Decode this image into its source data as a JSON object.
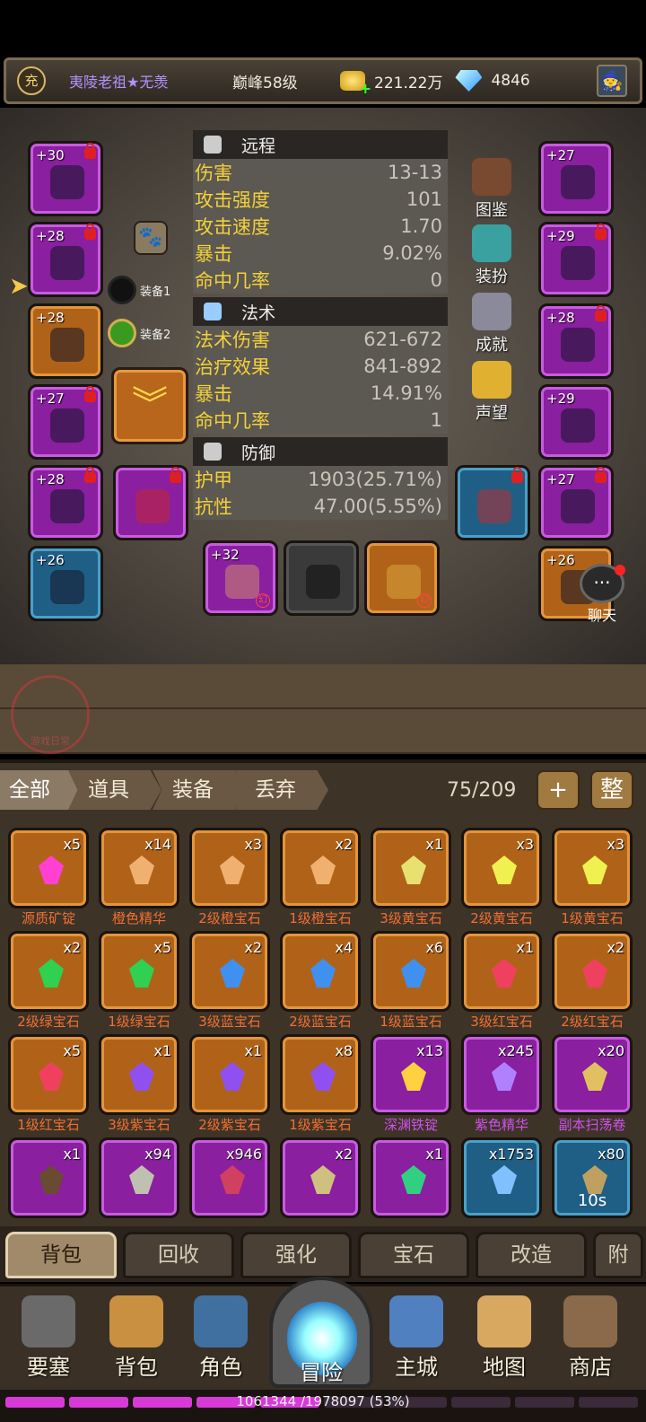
{
  "topbar": {
    "badge": "充",
    "player_name": "夷陵老祖★无羡",
    "level": "巅峰58级",
    "gold": "221.22万",
    "gems": "4846"
  },
  "colors": {
    "purple": "#8a1fa0",
    "orange": "#b06318",
    "blue": "#1f5f86",
    "stat_key": "#f2d13a",
    "item_name_orange": "#f07030",
    "item_name_purple": "#d050f0"
  },
  "stats": {
    "ranged": {
      "header": "远程",
      "rows": [
        {
          "k": "伤害",
          "v": "13-13"
        },
        {
          "k": "攻击强度",
          "v": "101"
        },
        {
          "k": "攻击速度",
          "v": "1.70"
        },
        {
          "k": "暴击",
          "v": "9.02%"
        },
        {
          "k": "命中几率",
          "v": "0"
        }
      ]
    },
    "magic": {
      "header": "法术",
      "rows": [
        {
          "k": "法术伤害",
          "v": "621-672"
        },
        {
          "k": "治疗效果",
          "v": "841-892"
        },
        {
          "k": "暴击",
          "v": "14.91%"
        },
        {
          "k": "命中几率",
          "v": "1"
        }
      ]
    },
    "defense": {
      "header": "防御",
      "rows": [
        {
          "k": "护甲",
          "v": "1903(25.71%)"
        },
        {
          "k": "抗性",
          "v": "47.00(5.55%)"
        }
      ]
    }
  },
  "side_buttons": [
    "图鉴",
    "装扮",
    "成就",
    "声望"
  ],
  "equip_sets": [
    "装备1",
    "装备2"
  ],
  "slots_left": [
    {
      "lv": "+30",
      "lock": true,
      "c": "purple",
      "icon": "helmet-icon"
    },
    {
      "lv": "+28",
      "lock": true,
      "c": "purple",
      "icon": "necklace-icon"
    },
    {
      "lv": "+28",
      "lock": false,
      "c": "orange",
      "icon": "shoulder-icon"
    },
    {
      "lv": "+27",
      "lock": true,
      "c": "purple",
      "icon": "cloak-icon"
    },
    {
      "lv": "+28",
      "lock": true,
      "c": "purple",
      "icon": "chest-armor-icon"
    },
    {
      "lv": "+26",
      "lock": false,
      "c": "blue",
      "icon": "ring-icon"
    }
  ],
  "slots_right": [
    {
      "lv": "+27",
      "lock": false,
      "c": "purple",
      "icon": "glove-icon"
    },
    {
      "lv": "+29",
      "lock": true,
      "c": "purple",
      "icon": "belt-icon"
    },
    {
      "lv": "+28",
      "lock": true,
      "c": "purple",
      "icon": "bracer-icon"
    },
    {
      "lv": "+29",
      "lock": false,
      "c": "purple",
      "icon": "legs-icon"
    },
    {
      "lv": "+27",
      "lock": true,
      "c": "purple",
      "icon": "boots-icon"
    },
    {
      "lv": "+26",
      "lock": false,
      "c": "orange",
      "icon": "ring-icon"
    }
  ],
  "weapons": [
    {
      "lv": "+32",
      "c": "purple",
      "huan": "幻"
    },
    {
      "lv": "",
      "c": "grey",
      "huan": ""
    },
    {
      "lv": "",
      "c": "orange",
      "huan": "幻"
    }
  ],
  "chat": "聊天",
  "watermark": "游戏日常",
  "filter_tabs": [
    "全部",
    "道具",
    "装备",
    "丢弃"
  ],
  "bag_count": "75/209",
  "bag_buttons": [
    "+",
    "整"
  ],
  "items": [
    {
      "n": "源质矿锭",
      "q": "x5",
      "c": "orange",
      "g": "#ff40d0",
      "p": false
    },
    {
      "n": "橙色精华",
      "q": "x14",
      "c": "orange",
      "g": "#f0b070",
      "p": false
    },
    {
      "n": "2级橙宝石",
      "q": "x3",
      "c": "orange",
      "g": "#f0b070",
      "p": false
    },
    {
      "n": "1级橙宝石",
      "q": "x2",
      "c": "orange",
      "g": "#f0b070",
      "p": false
    },
    {
      "n": "3级黄宝石",
      "q": "x1",
      "c": "orange",
      "g": "#e8e070",
      "p": false
    },
    {
      "n": "2级黄宝石",
      "q": "x3",
      "c": "orange",
      "g": "#f0f050",
      "p": false
    },
    {
      "n": "1级黄宝石",
      "q": "x3",
      "c": "orange",
      "g": "#f0f050",
      "p": false
    },
    {
      "n": "2级绿宝石",
      "q": "x2",
      "c": "orange",
      "g": "#30d050",
      "p": false
    },
    {
      "n": "1级绿宝石",
      "q": "x5",
      "c": "orange",
      "g": "#30d050",
      "p": false
    },
    {
      "n": "3级蓝宝石",
      "q": "x2",
      "c": "orange",
      "g": "#4090f0",
      "p": false
    },
    {
      "n": "2级蓝宝石",
      "q": "x4",
      "c": "orange",
      "g": "#4090f0",
      "p": false
    },
    {
      "n": "1级蓝宝石",
      "q": "x6",
      "c": "orange",
      "g": "#4090f0",
      "p": false
    },
    {
      "n": "3级红宝石",
      "q": "x1",
      "c": "orange",
      "g": "#f04060",
      "p": false
    },
    {
      "n": "2级红宝石",
      "q": "x2",
      "c": "orange",
      "g": "#f04060",
      "p": false
    },
    {
      "n": "1级红宝石",
      "q": "x5",
      "c": "orange",
      "g": "#f04060",
      "p": false
    },
    {
      "n": "3级紫宝石",
      "q": "x1",
      "c": "orange",
      "g": "#9050f0",
      "p": false
    },
    {
      "n": "2级紫宝石",
      "q": "x1",
      "c": "orange",
      "g": "#9050f0",
      "p": false
    },
    {
      "n": "1级紫宝石",
      "q": "x8",
      "c": "orange",
      "g": "#9050f0",
      "p": false
    },
    {
      "n": "深渊铁锭",
      "q": "x13",
      "c": "purple",
      "g": "#ffd040",
      "p": true
    },
    {
      "n": "紫色精华",
      "q": "x245",
      "c": "purple",
      "g": "#b080ff",
      "p": true
    },
    {
      "n": "副本扫荡卷",
      "q": "x20",
      "c": "purple",
      "g": "#e0c060",
      "p": true
    },
    {
      "n": "",
      "q": "x1",
      "c": "purple",
      "g": "#6a4a30",
      "p": true
    },
    {
      "n": "",
      "q": "x94",
      "c": "purple",
      "g": "#c0c0b0",
      "p": true
    },
    {
      "n": "",
      "q": "x946",
      "c": "purple",
      "g": "#d04060",
      "p": true
    },
    {
      "n": "",
      "q": "x2",
      "c": "purple",
      "g": "#d0c080",
      "p": true
    },
    {
      "n": "",
      "q": "x1",
      "c": "purple",
      "g": "#30d080",
      "p": true
    },
    {
      "n": "",
      "q": "x1753",
      "c": "blue",
      "g": "#80c0ff",
      "p": false
    },
    {
      "n": "",
      "q": "x80",
      "c": "blue",
      "g": "#c0a060",
      "p": false,
      "timer": "10s"
    }
  ],
  "sub_tabs": [
    "背包",
    "回收",
    "强化",
    "宝石",
    "改造",
    "附"
  ],
  "nav": [
    "要塞",
    "背包",
    "角色",
    "冒险",
    "主城",
    "地图",
    "商店"
  ],
  "xp": {
    "text": "1061344 /1978097 (53%)",
    "fraction": 0.53
  }
}
